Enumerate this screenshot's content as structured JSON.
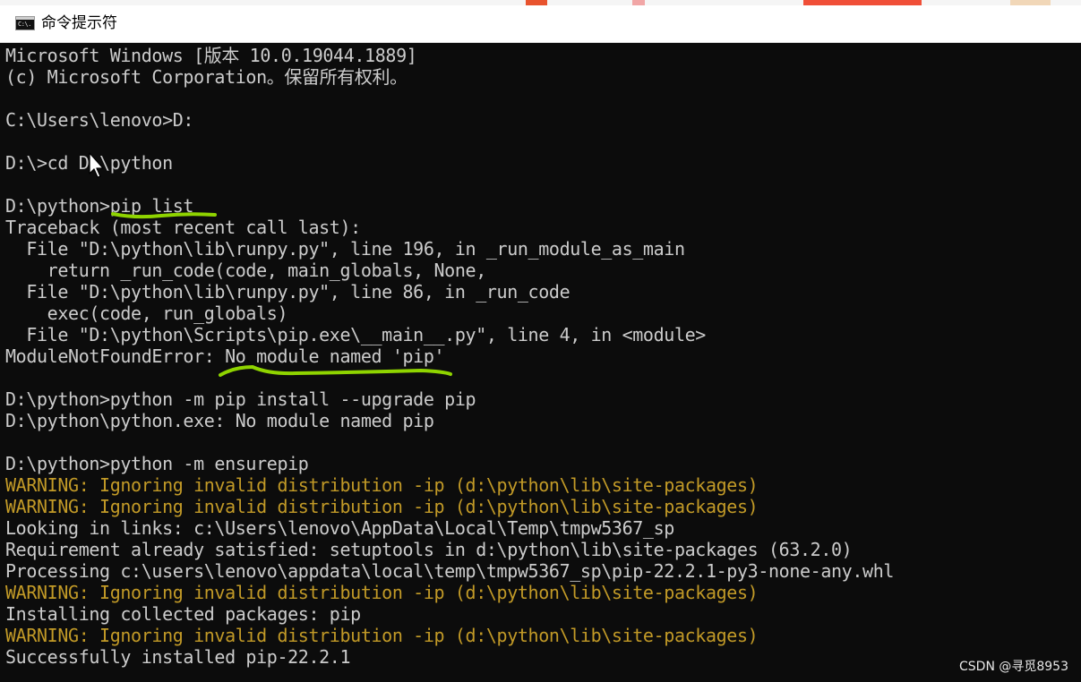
{
  "window": {
    "title": "命令提示符",
    "icon": "console-app-icon",
    "icon_text": "C:\\."
  },
  "console": {
    "lines": [
      {
        "text": "Microsoft Windows [版本 10.0.19044.1889]",
        "type": "output"
      },
      {
        "text": "(c) Microsoft Corporation。保留所有权利。",
        "type": "output"
      },
      {
        "text": "",
        "type": "blank"
      },
      {
        "text": "C:\\Users\\lenovo>D:",
        "type": "command"
      },
      {
        "text": "",
        "type": "blank"
      },
      {
        "text": "D:\\>cd D:\\python",
        "type": "command"
      },
      {
        "text": "",
        "type": "blank"
      },
      {
        "text": "D:\\python>pip list",
        "type": "command"
      },
      {
        "text": "Traceback (most recent call last):",
        "type": "output"
      },
      {
        "text": "  File \"D:\\python\\lib\\runpy.py\", line 196, in _run_module_as_main",
        "type": "output"
      },
      {
        "text": "    return _run_code(code, main_globals, None,",
        "type": "output"
      },
      {
        "text": "  File \"D:\\python\\lib\\runpy.py\", line 86, in _run_code",
        "type": "output"
      },
      {
        "text": "    exec(code, run_globals)",
        "type": "output"
      },
      {
        "text": "  File \"D:\\python\\Scripts\\pip.exe\\__main__.py\", line 4, in <module>",
        "type": "output"
      },
      {
        "text": "ModuleNotFoundError: No module named 'pip'",
        "type": "output"
      },
      {
        "text": "",
        "type": "blank"
      },
      {
        "text": "D:\\python>python -m pip install --upgrade pip",
        "type": "command"
      },
      {
        "text": "D:\\python\\python.exe: No module named pip",
        "type": "output"
      },
      {
        "text": "",
        "type": "blank"
      },
      {
        "text": "D:\\python>python -m ensurepip",
        "type": "command"
      },
      {
        "text": "WARNING: Ignoring invalid distribution -ip (d:\\python\\lib\\site-packages)",
        "type": "warning"
      },
      {
        "text": "WARNING: Ignoring invalid distribution -ip (d:\\python\\lib\\site-packages)",
        "type": "warning"
      },
      {
        "text": "Looking in links: c:\\Users\\lenovo\\AppData\\Local\\Temp\\tmpw5367_sp",
        "type": "output"
      },
      {
        "text": "Requirement already satisfied: setuptools in d:\\python\\lib\\site-packages (63.2.0)",
        "type": "output"
      },
      {
        "text": "Processing c:\\users\\lenovo\\appdata\\local\\temp\\tmpw5367_sp\\pip-22.2.1-py3-none-any.whl",
        "type": "output"
      },
      {
        "text": "WARNING: Ignoring invalid distribution -ip (d:\\python\\lib\\site-packages)",
        "type": "warning"
      },
      {
        "text": "Installing collected packages: pip",
        "type": "output"
      },
      {
        "text": "WARNING: Ignoring invalid distribution -ip (d:\\python\\lib\\site-packages)",
        "type": "warning"
      },
      {
        "text": "Successfully installed pip-22.2.1",
        "type": "output"
      }
    ]
  },
  "watermark": {
    "text": "CSDN @寻觅8953"
  },
  "colors": {
    "console_bg": "#0c0c0c",
    "console_text": "#cccccc",
    "warning_text": "#c29a27",
    "highlight_mark": "#8fd400",
    "titlebar_bg": "#ffffff"
  }
}
